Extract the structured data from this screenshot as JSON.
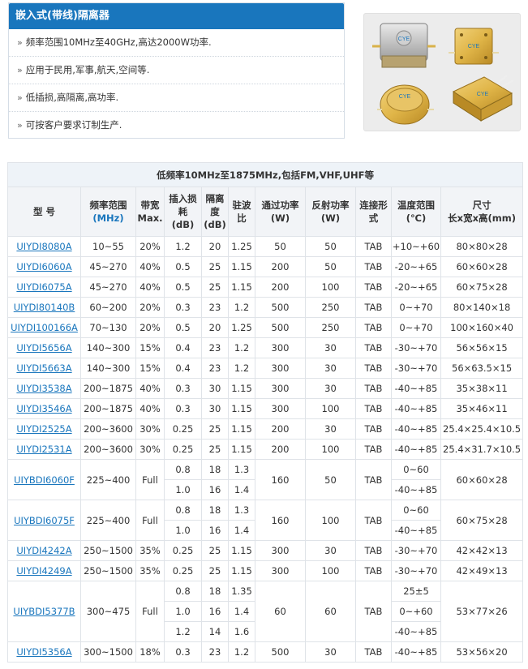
{
  "panel": {
    "title": "嵌入式(带线)隔离器",
    "features": [
      "频率范围10MHz至40GHz,高达2000W功率.",
      "应用于民用,军事,航天,空间等.",
      "低插损,高隔离,高功率.",
      "可按客户要求订制生产."
    ]
  },
  "image_logo_text": "CYE",
  "table": {
    "caption": "低频率10MHz至1875MHz,包括FM,VHF,UHF等",
    "headers": [
      {
        "l1": "型 号",
        "l2": ""
      },
      {
        "l1": "频率范围",
        "l2": "(MHz)"
      },
      {
        "l1": "带宽",
        "l2": "Max."
      },
      {
        "l1": "插入损耗",
        "l2": "(dB)"
      },
      {
        "l1": "隔离度",
        "l2": "(dB)"
      },
      {
        "l1": "驻波比",
        "l2": ""
      },
      {
        "l1": "通过功率",
        "l2": "(W)"
      },
      {
        "l1": "反射功率",
        "l2": "(W)"
      },
      {
        "l1": "连接形式",
        "l2": ""
      },
      {
        "l1": "温度范围",
        "l2": "(℃)"
      },
      {
        "l1": "尺寸",
        "l2": "长x宽x高(mm)"
      }
    ],
    "rows": [
      [
        "UIYDI8080A",
        "10~55",
        "20%",
        "1.2",
        "20",
        "1.25",
        "50",
        "50",
        "TAB",
        "+10~+60",
        "80×80×28"
      ],
      [
        "UIYDI6060A",
        "45~270",
        "40%",
        "0.5",
        "25",
        "1.15",
        "200",
        "50",
        "TAB",
        "-20~+65",
        "60×60×28"
      ],
      [
        "UIYDI6075A",
        "45~270",
        "40%",
        "0.5",
        "25",
        "1.15",
        "200",
        "100",
        "TAB",
        "-20~+65",
        "60×75×28"
      ],
      [
        "UIYDI80140B",
        "60~200",
        "20%",
        "0.3",
        "23",
        "1.2",
        "500",
        "250",
        "TAB",
        "0~+70",
        "80×140×18"
      ],
      [
        "UIYDI100166A",
        "70~130",
        "20%",
        "0.5",
        "20",
        "1.25",
        "500",
        "250",
        "TAB",
        "0~+70",
        "100×160×40"
      ],
      [
        "UIYDI5656A",
        "140~300",
        "15%",
        "0.4",
        "23",
        "1.2",
        "300",
        "30",
        "TAB",
        "-30~+70",
        "56×56×15"
      ],
      [
        "UIYDI5663A",
        "140~300",
        "15%",
        "0.4",
        "23",
        "1.2",
        "300",
        "30",
        "TAB",
        "-30~+70",
        "56×63.5×15"
      ],
      [
        "UIYDI3538A",
        "200~1875",
        "40%",
        "0.3",
        "30",
        "1.15",
        "300",
        "30",
        "TAB",
        "-40~+85",
        "35×38×11"
      ],
      [
        "UIYDI3546A",
        "200~1875",
        "40%",
        "0.3",
        "30",
        "1.15",
        "300",
        "100",
        "TAB",
        "-40~+85",
        "35×46×11"
      ],
      [
        "UIYDI2525A",
        "200~3600",
        "30%",
        "0.25",
        "25",
        "1.15",
        "200",
        "30",
        "TAB",
        "-40~+85",
        "25.4×25.4×10.5"
      ],
      [
        "UIYDI2531A",
        "200~3600",
        "30%",
        "0.25",
        "25",
        "1.15",
        "200",
        "100",
        "TAB",
        "-40~+85",
        "25.4×31.7×10.5"
      ]
    ],
    "group1": {
      "model": "UIYBDI6060F",
      "freq": "225~400",
      "bw": "Full",
      "sub": [
        [
          "0.8",
          "18",
          "1.3"
        ],
        [
          "1.0",
          "16",
          "1.4"
        ]
      ],
      "fwd": "160",
      "rev": "50",
      "conn": "TAB",
      "temps": [
        "0~60",
        "-40~+85"
      ],
      "size": "60×60×28"
    },
    "group2": {
      "model": "UIYBDI6075F",
      "freq": "225~400",
      "bw": "Full",
      "sub": [
        [
          "0.8",
          "18",
          "1.3"
        ],
        [
          "1.0",
          "16",
          "1.4"
        ]
      ],
      "fwd": "160",
      "rev": "100",
      "conn": "TAB",
      "temps": [
        "0~60",
        "-40~+85"
      ],
      "size": "60×75×28"
    },
    "rows2": [
      [
        "UIYDI4242A",
        "250~1500",
        "35%",
        "0.25",
        "25",
        "1.15",
        "300",
        "30",
        "TAB",
        "-30~+70",
        "42×42×13"
      ],
      [
        "UIYDI4249A",
        "250~1500",
        "35%",
        "0.25",
        "25",
        "1.15",
        "300",
        "100",
        "TAB",
        "-30~+70",
        "42×49×13"
      ]
    ],
    "group3": {
      "model": "UIYBDI5377B",
      "freq": "300~475",
      "bw": "Full",
      "sub": [
        [
          "0.8",
          "18",
          "1.35"
        ],
        [
          "1.0",
          "16",
          "1.4"
        ],
        [
          "1.2",
          "14",
          "1.6"
        ]
      ],
      "fwd": "60",
      "rev": "60",
      "conn": "TAB",
      "temps": [
        "25±5",
        "0~+60",
        "-40~+85"
      ],
      "size": "53×77×26"
    },
    "last_row": [
      "UIYDI5356A",
      "300~1500",
      "18%",
      "0.3",
      "23",
      "1.2",
      "500",
      "30",
      "TAB",
      "-40~+85",
      "53×56×20"
    ]
  }
}
